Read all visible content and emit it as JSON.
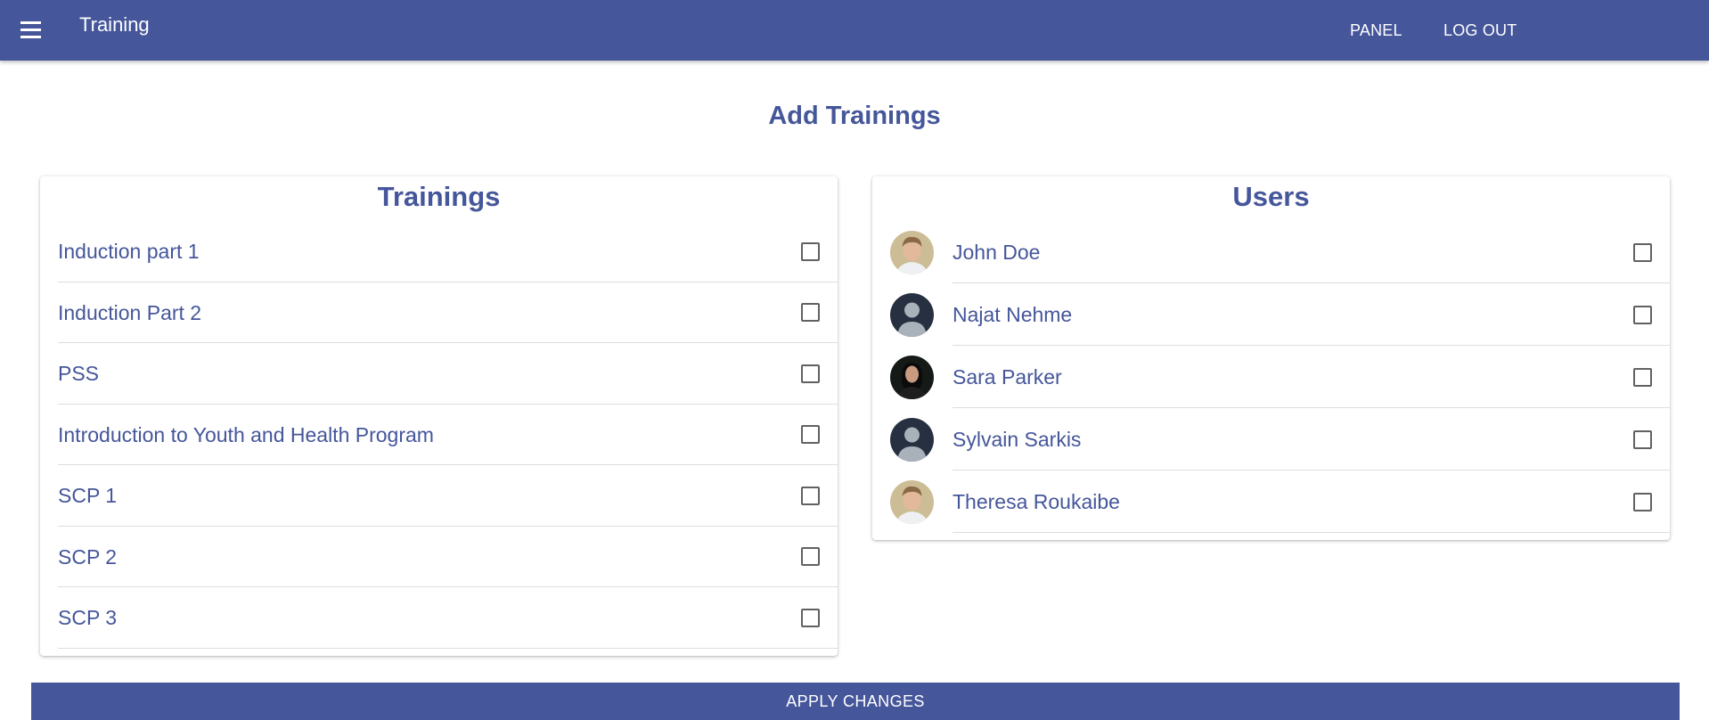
{
  "appbar": {
    "menu_icon": "menu-icon",
    "title": "Training",
    "panel_label": "PANEL",
    "logout_label": "LOG OUT",
    "color": "#45569a"
  },
  "page": {
    "title": "Add Trainings"
  },
  "trainings": {
    "title": "Trainings",
    "items": [
      {
        "label": "Induction part 1",
        "checked": false
      },
      {
        "label": "Induction Part 2",
        "checked": false
      },
      {
        "label": "PSS",
        "checked": false
      },
      {
        "label": "Introduction to Youth and Health Program",
        "checked": false
      },
      {
        "label": "SCP 1",
        "checked": false
      },
      {
        "label": "SCP 2",
        "checked": false
      },
      {
        "label": "SCP 3",
        "checked": false
      }
    ]
  },
  "users": {
    "title": "Users",
    "items": [
      {
        "name": "John Doe",
        "avatar": "photo-avatar-icon",
        "checked": false
      },
      {
        "name": "Najat Nehme",
        "avatar": "default-user-avatar-icon",
        "checked": false
      },
      {
        "name": "Sara Parker",
        "avatar": "photo-avatar-icon",
        "checked": false
      },
      {
        "name": "Sylvain Sarkis",
        "avatar": "default-user-avatar-icon",
        "checked": false
      },
      {
        "name": "Theresa Roukaibe",
        "avatar": "photo-avatar-icon",
        "checked": false
      }
    ]
  },
  "actions": {
    "apply_label": "APPLY CHANGES"
  }
}
